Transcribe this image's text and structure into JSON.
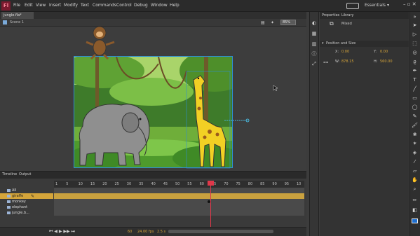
{
  "app": {
    "logo": "Fl",
    "essentials": "Essentials"
  },
  "menu": [
    "File",
    "Edit",
    "View",
    "Insert",
    "Modify",
    "Text",
    "Commands",
    "Control",
    "Debug",
    "Window",
    "Help"
  ],
  "document": {
    "tab": "jungle.fla*",
    "scene": "Scene 1",
    "zoom": "85%"
  },
  "timeline": {
    "tabs": [
      "Timeline",
      "Output"
    ],
    "layers": [
      {
        "name": "All",
        "selected": false
      },
      {
        "name": "giraffe",
        "selected": true
      },
      {
        "name": "monkey",
        "selected": false
      },
      {
        "name": "elephant",
        "selected": false
      },
      {
        "name": "jungle.b...",
        "selected": false
      }
    ],
    "ruler": [
      "1",
      "5",
      "10",
      "15",
      "20",
      "25",
      "30",
      "35",
      "40",
      "45",
      "50",
      "55",
      "60",
      "65",
      "70",
      "75",
      "80",
      "85",
      "90",
      "95",
      "10"
    ],
    "current_frame": "60",
    "fps": "24.00 fps",
    "time": "2.5 s"
  },
  "properties": {
    "tabs": [
      "Properties",
      "Library"
    ],
    "mixed": "Mixed",
    "section": "Position and Size",
    "x_label": "X:",
    "x_value": "0.00",
    "y_label": "Y:",
    "y_value": "0.00",
    "w_label": "W:",
    "w_value": "878.15",
    "h_label": "H:",
    "h_value": "560.00"
  },
  "colors": {
    "selected_layer": "#d5a53a",
    "playhead": "#e0384a",
    "stage_border": "#2e8fd6"
  }
}
